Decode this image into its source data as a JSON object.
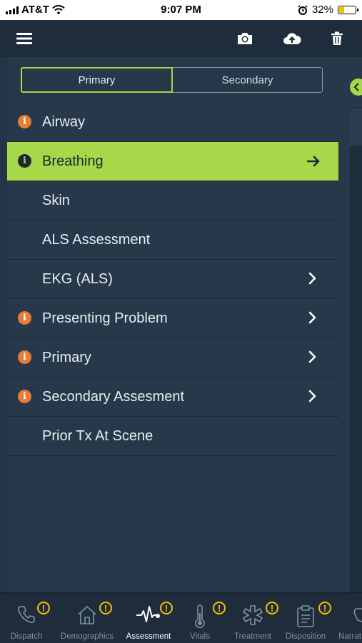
{
  "status_bar": {
    "carrier": "AT&T",
    "time": "9:07 PM",
    "battery": "32%",
    "battery_level": 0.32
  },
  "header": {
    "icons": [
      "menu-icon",
      "camera-icon",
      "upload-icon",
      "trash-icon"
    ]
  },
  "segment": {
    "primary": "Primary",
    "secondary": "Secondary",
    "selected": "Primary"
  },
  "list": {
    "items": [
      {
        "label": "Airway",
        "info": true,
        "chevron": false,
        "active": false
      },
      {
        "label": "Breathing",
        "info": true,
        "chevron": false,
        "arrow": true,
        "active": true
      },
      {
        "label": "Skin",
        "info": false,
        "chevron": false,
        "active": false
      },
      {
        "label": "ALS Assessment",
        "info": false,
        "chevron": false,
        "active": false
      },
      {
        "label": "EKG (ALS)",
        "info": false,
        "chevron": true,
        "active": false
      },
      {
        "label": "Presenting Problem",
        "info": true,
        "chevron": true,
        "active": false
      },
      {
        "label": "Primary",
        "info": true,
        "chevron": true,
        "active": false
      },
      {
        "label": "Secondary Assesment",
        "info": true,
        "chevron": true,
        "active": false
      },
      {
        "label": "Prior Tx At Scene",
        "info": false,
        "chevron": false,
        "active": false
      }
    ]
  },
  "tabs": [
    {
      "label": "Dispatch",
      "badge": "!",
      "icon": "phone-icon"
    },
    {
      "label": "Demographics",
      "badge": "!",
      "icon": "house-icon"
    },
    {
      "label": "Assessment",
      "badge": "!",
      "icon": "pulse-icon",
      "active": true
    },
    {
      "label": "Vitals",
      "badge": "!",
      "icon": "thermometer-icon"
    },
    {
      "label": "Treatment",
      "badge": "!",
      "icon": "star-of-life-icon"
    },
    {
      "label": "Disposition",
      "badge": "!",
      "icon": "clipboard-icon"
    },
    {
      "label": "Narrat",
      "icon": "hand-icon"
    }
  ],
  "colors": {
    "accent": "#a6d849",
    "warning": "#e87b35",
    "badge": "#f2c200",
    "background": "#243447"
  }
}
